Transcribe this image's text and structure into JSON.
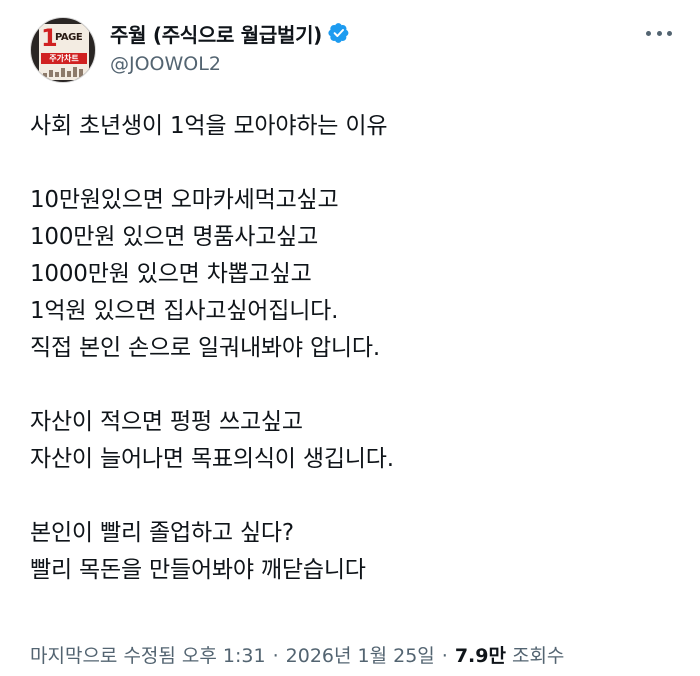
{
  "author": {
    "display_name": "주월 (주식으로 월급벌기)",
    "handle": "@JOOWOL2",
    "avatar_text_1": "1",
    "avatar_text_page": "PAGE",
    "avatar_text_band": "주가차트"
  },
  "icons": {
    "verified": "verified-badge-icon",
    "more": "more-options-icon"
  },
  "colors": {
    "verified": "#1d9bf0",
    "text": "#0f1419",
    "secondary": "#536471"
  },
  "tweet": {
    "lines": [
      "사회 초년생이 1억을 모아야하는 이유",
      "",
      "10만원있으면 오마카세먹고싶고",
      "100만원 있으면 명품사고싶고",
      "1000만원 있으면 차뽑고싶고",
      "1억원 있으면 집사고싶어집니다.",
      "직접 본인 손으로 일궈내봐야 압니다.",
      "",
      "자산이 적으면 펑펑 쓰고싶고",
      "자산이 늘어나면 목표의식이 생깁니다.",
      "",
      "본인이 빨리 졸업하고 싶다?",
      "빨리 목돈을 만들어봐야 깨닫습니다"
    ]
  },
  "meta": {
    "edited_time": "마지막으로 수정됨 오후 1:31",
    "separator": "·",
    "date": "2026년 1월 25일",
    "views_count": "7.9만",
    "views_label": "조회수"
  }
}
